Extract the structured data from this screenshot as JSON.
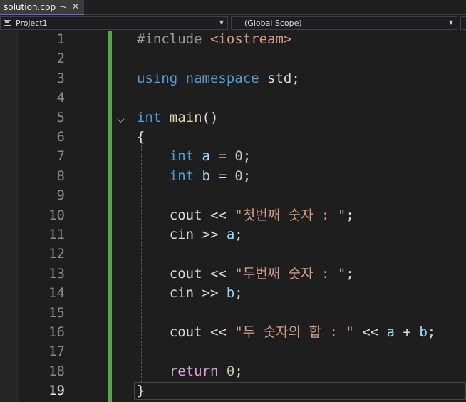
{
  "tab": {
    "label": "solution.cpp",
    "pin_icon": "pin-icon",
    "close_glyph": "✕"
  },
  "navbar": {
    "project": "Project1",
    "scope": "(Global Scope)"
  },
  "editor": {
    "current_line": 19,
    "colors": {
      "keyword": "#569cd6",
      "control": "#d8a0df",
      "string": "#d69d85",
      "number": "#b5cea8",
      "function": "#dcdcaa",
      "variable": "#9cdcfe",
      "include": "#9b9b9b",
      "text": "#dcdcdc",
      "change_bar": "#57a64a"
    },
    "lines": [
      {
        "n": "1",
        "tokens": [
          {
            "t": "#include ",
            "c": "include"
          },
          {
            "t": "<iostream>",
            "c": "string"
          }
        ]
      },
      {
        "n": "2",
        "tokens": []
      },
      {
        "n": "3",
        "tokens": [
          {
            "t": "using",
            "c": "keyword"
          },
          {
            "t": " ",
            "c": "text"
          },
          {
            "t": "namespace",
            "c": "keyword"
          },
          {
            "t": " std;",
            "c": "text"
          }
        ]
      },
      {
        "n": "4",
        "tokens": []
      },
      {
        "n": "5",
        "tokens": [
          {
            "t": "int",
            "c": "keyword"
          },
          {
            "t": " ",
            "c": "text"
          },
          {
            "t": "main",
            "c": "function"
          },
          {
            "t": "()",
            "c": "text"
          }
        ]
      },
      {
        "n": "6",
        "tokens": [
          {
            "t": "{",
            "c": "text"
          }
        ]
      },
      {
        "n": "7",
        "tokens": [
          {
            "t": "    ",
            "c": "text"
          },
          {
            "t": "int",
            "c": "keyword"
          },
          {
            "t": " ",
            "c": "text"
          },
          {
            "t": "a",
            "c": "variable"
          },
          {
            "t": " = ",
            "c": "text"
          },
          {
            "t": "0",
            "c": "number"
          },
          {
            "t": ";",
            "c": "text"
          }
        ]
      },
      {
        "n": "8",
        "tokens": [
          {
            "t": "    ",
            "c": "text"
          },
          {
            "t": "int",
            "c": "keyword"
          },
          {
            "t": " ",
            "c": "text"
          },
          {
            "t": "b",
            "c": "variable"
          },
          {
            "t": " = ",
            "c": "text"
          },
          {
            "t": "0",
            "c": "number"
          },
          {
            "t": ";",
            "c": "text"
          }
        ]
      },
      {
        "n": "9",
        "tokens": []
      },
      {
        "n": "10",
        "tokens": [
          {
            "t": "    cout << ",
            "c": "text"
          },
          {
            "t": "\"첫번째 숫자 : \"",
            "c": "string"
          },
          {
            "t": ";",
            "c": "text"
          }
        ]
      },
      {
        "n": "11",
        "tokens": [
          {
            "t": "    cin >> ",
            "c": "text"
          },
          {
            "t": "a",
            "c": "variable"
          },
          {
            "t": ";",
            "c": "text"
          }
        ]
      },
      {
        "n": "12",
        "tokens": []
      },
      {
        "n": "13",
        "tokens": [
          {
            "t": "    cout << ",
            "c": "text"
          },
          {
            "t": "\"두번째 숫자 : \"",
            "c": "string"
          },
          {
            "t": ";",
            "c": "text"
          }
        ]
      },
      {
        "n": "14",
        "tokens": [
          {
            "t": "    cin >> ",
            "c": "text"
          },
          {
            "t": "b",
            "c": "variable"
          },
          {
            "t": ";",
            "c": "text"
          }
        ]
      },
      {
        "n": "15",
        "tokens": []
      },
      {
        "n": "16",
        "tokens": [
          {
            "t": "    cout << ",
            "c": "text"
          },
          {
            "t": "\"두 숫자의 합 : \"",
            "c": "string"
          },
          {
            "t": " << ",
            "c": "text"
          },
          {
            "t": "a",
            "c": "variable"
          },
          {
            "t": " + ",
            "c": "text"
          },
          {
            "t": "b",
            "c": "variable"
          },
          {
            "t": ";",
            "c": "text"
          }
        ]
      },
      {
        "n": "17",
        "tokens": []
      },
      {
        "n": "18",
        "tokens": [
          {
            "t": "    ",
            "c": "text"
          },
          {
            "t": "return",
            "c": "control"
          },
          {
            "t": " ",
            "c": "text"
          },
          {
            "t": "0",
            "c": "number"
          },
          {
            "t": ";",
            "c": "text"
          }
        ]
      },
      {
        "n": "19",
        "tokens": [
          {
            "t": "}",
            "c": "text"
          }
        ]
      }
    ]
  }
}
